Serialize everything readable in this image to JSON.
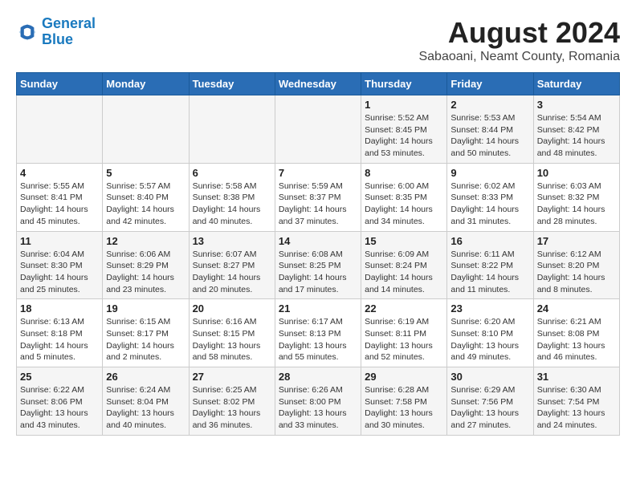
{
  "logo": {
    "line1": "General",
    "line2": "Blue"
  },
  "title": {
    "month_year": "August 2024",
    "location": "Sabaoani, Neamt County, Romania"
  },
  "headers": [
    "Sunday",
    "Monday",
    "Tuesday",
    "Wednesday",
    "Thursday",
    "Friday",
    "Saturday"
  ],
  "weeks": [
    [
      {
        "day": "",
        "info": ""
      },
      {
        "day": "",
        "info": ""
      },
      {
        "day": "",
        "info": ""
      },
      {
        "day": "",
        "info": ""
      },
      {
        "day": "1",
        "info": "Sunrise: 5:52 AM\nSunset: 8:45 PM\nDaylight: 14 hours\nand 53 minutes."
      },
      {
        "day": "2",
        "info": "Sunrise: 5:53 AM\nSunset: 8:44 PM\nDaylight: 14 hours\nand 50 minutes."
      },
      {
        "day": "3",
        "info": "Sunrise: 5:54 AM\nSunset: 8:42 PM\nDaylight: 14 hours\nand 48 minutes."
      }
    ],
    [
      {
        "day": "4",
        "info": "Sunrise: 5:55 AM\nSunset: 8:41 PM\nDaylight: 14 hours\nand 45 minutes."
      },
      {
        "day": "5",
        "info": "Sunrise: 5:57 AM\nSunset: 8:40 PM\nDaylight: 14 hours\nand 42 minutes."
      },
      {
        "day": "6",
        "info": "Sunrise: 5:58 AM\nSunset: 8:38 PM\nDaylight: 14 hours\nand 40 minutes."
      },
      {
        "day": "7",
        "info": "Sunrise: 5:59 AM\nSunset: 8:37 PM\nDaylight: 14 hours\nand 37 minutes."
      },
      {
        "day": "8",
        "info": "Sunrise: 6:00 AM\nSunset: 8:35 PM\nDaylight: 14 hours\nand 34 minutes."
      },
      {
        "day": "9",
        "info": "Sunrise: 6:02 AM\nSunset: 8:33 PM\nDaylight: 14 hours\nand 31 minutes."
      },
      {
        "day": "10",
        "info": "Sunrise: 6:03 AM\nSunset: 8:32 PM\nDaylight: 14 hours\nand 28 minutes."
      }
    ],
    [
      {
        "day": "11",
        "info": "Sunrise: 6:04 AM\nSunset: 8:30 PM\nDaylight: 14 hours\nand 25 minutes."
      },
      {
        "day": "12",
        "info": "Sunrise: 6:06 AM\nSunset: 8:29 PM\nDaylight: 14 hours\nand 23 minutes."
      },
      {
        "day": "13",
        "info": "Sunrise: 6:07 AM\nSunset: 8:27 PM\nDaylight: 14 hours\nand 20 minutes."
      },
      {
        "day": "14",
        "info": "Sunrise: 6:08 AM\nSunset: 8:25 PM\nDaylight: 14 hours\nand 17 minutes."
      },
      {
        "day": "15",
        "info": "Sunrise: 6:09 AM\nSunset: 8:24 PM\nDaylight: 14 hours\nand 14 minutes."
      },
      {
        "day": "16",
        "info": "Sunrise: 6:11 AM\nSunset: 8:22 PM\nDaylight: 14 hours\nand 11 minutes."
      },
      {
        "day": "17",
        "info": "Sunrise: 6:12 AM\nSunset: 8:20 PM\nDaylight: 14 hours\nand 8 minutes."
      }
    ],
    [
      {
        "day": "18",
        "info": "Sunrise: 6:13 AM\nSunset: 8:18 PM\nDaylight: 14 hours\nand 5 minutes."
      },
      {
        "day": "19",
        "info": "Sunrise: 6:15 AM\nSunset: 8:17 PM\nDaylight: 14 hours\nand 2 minutes."
      },
      {
        "day": "20",
        "info": "Sunrise: 6:16 AM\nSunset: 8:15 PM\nDaylight: 13 hours\nand 58 minutes."
      },
      {
        "day": "21",
        "info": "Sunrise: 6:17 AM\nSunset: 8:13 PM\nDaylight: 13 hours\nand 55 minutes."
      },
      {
        "day": "22",
        "info": "Sunrise: 6:19 AM\nSunset: 8:11 PM\nDaylight: 13 hours\nand 52 minutes."
      },
      {
        "day": "23",
        "info": "Sunrise: 6:20 AM\nSunset: 8:10 PM\nDaylight: 13 hours\nand 49 minutes."
      },
      {
        "day": "24",
        "info": "Sunrise: 6:21 AM\nSunset: 8:08 PM\nDaylight: 13 hours\nand 46 minutes."
      }
    ],
    [
      {
        "day": "25",
        "info": "Sunrise: 6:22 AM\nSunset: 8:06 PM\nDaylight: 13 hours\nand 43 minutes."
      },
      {
        "day": "26",
        "info": "Sunrise: 6:24 AM\nSunset: 8:04 PM\nDaylight: 13 hours\nand 40 minutes."
      },
      {
        "day": "27",
        "info": "Sunrise: 6:25 AM\nSunset: 8:02 PM\nDaylight: 13 hours\nand 36 minutes."
      },
      {
        "day": "28",
        "info": "Sunrise: 6:26 AM\nSunset: 8:00 PM\nDaylight: 13 hours\nand 33 minutes."
      },
      {
        "day": "29",
        "info": "Sunrise: 6:28 AM\nSunset: 7:58 PM\nDaylight: 13 hours\nand 30 minutes."
      },
      {
        "day": "30",
        "info": "Sunrise: 6:29 AM\nSunset: 7:56 PM\nDaylight: 13 hours\nand 27 minutes."
      },
      {
        "day": "31",
        "info": "Sunrise: 6:30 AM\nSunset: 7:54 PM\nDaylight: 13 hours\nand 24 minutes."
      }
    ]
  ]
}
